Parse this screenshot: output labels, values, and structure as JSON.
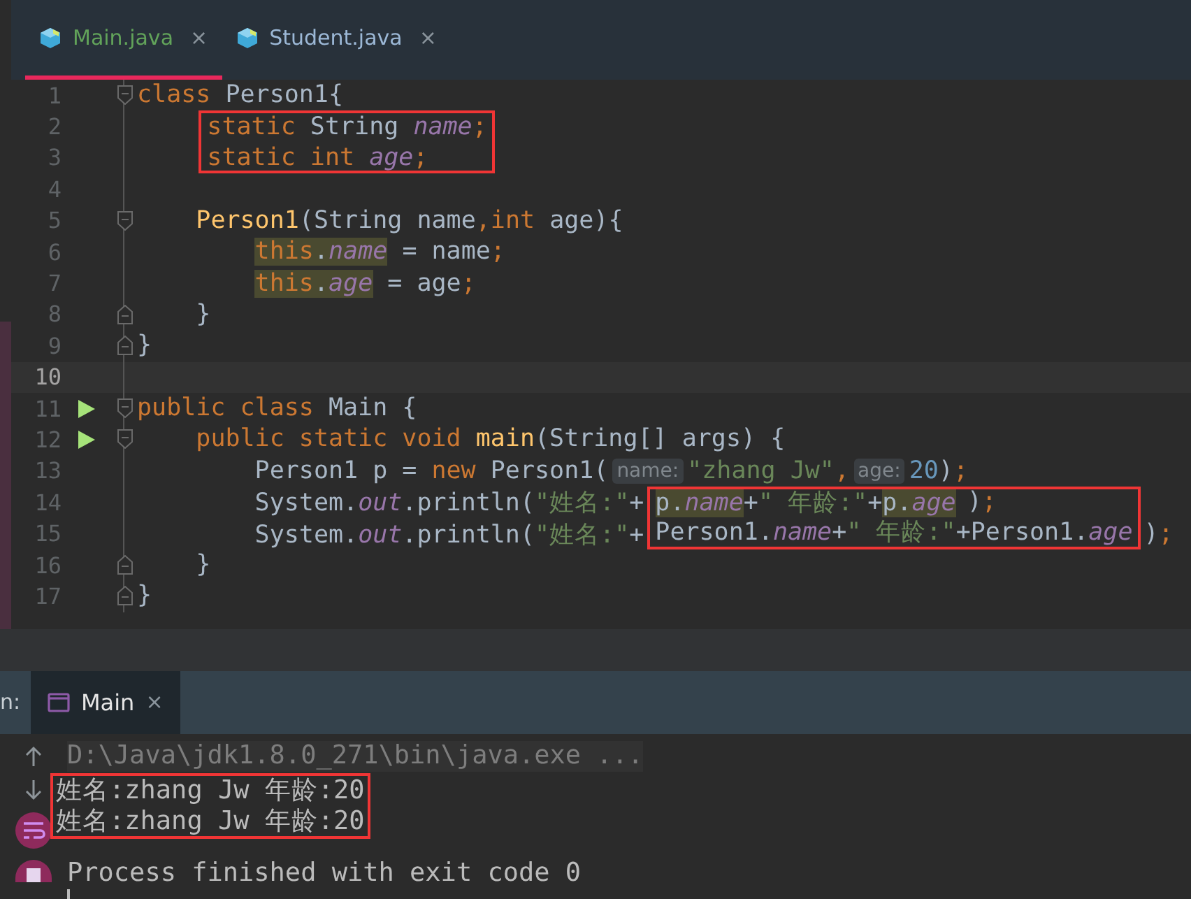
{
  "tabs": [
    {
      "label": "Main.java",
      "selected": true,
      "color": "#62a35a",
      "close": "×"
    },
    {
      "label": "Student.java",
      "selected": false,
      "color": "#9cb8d6",
      "close": "×"
    }
  ],
  "editor": {
    "lines": [
      {
        "number": "1",
        "kind": "fold_start",
        "segments": [
          {
            "tokens": [
              {
                "text": "class ",
                "kind": "keyword"
              },
              {
                "text": "Person1{",
                "kind": "plain"
              }
            ]
          }
        ]
      },
      {
        "number": "2",
        "kind": "code",
        "segments": [
          {
            "boxed": true,
            "tokens": [
              {
                "text": "    static ",
                "kind": "keyword"
              },
              {
                "text": "String ",
                "kind": "plain"
              },
              {
                "text": "name",
                "kind": "field"
              },
              {
                "text": ";",
                "kind": "punct"
              }
            ]
          }
        ]
      },
      {
        "number": "3",
        "kind": "code",
        "segments": [
          {
            "boxed": true,
            "tokens": [
              {
                "text": "    static int ",
                "kind": "keyword"
              },
              {
                "text": "age",
                "kind": "field"
              },
              {
                "text": ";",
                "kind": "punct"
              }
            ]
          }
        ]
      },
      {
        "number": "4",
        "kind": "code"
      },
      {
        "number": "5",
        "kind": "fold_start",
        "segments": [
          {
            "tokens": [
              {
                "text": "    Person1",
                "kind": "method"
              },
              {
                "text": "(String name",
                "kind": "plain"
              },
              {
                "text": ",",
                "kind": "punct"
              },
              {
                "text": "int ",
                "kind": "keyword"
              },
              {
                "text": "age){",
                "kind": "plain"
              }
            ]
          }
        ]
      },
      {
        "number": "6",
        "kind": "code",
        "segments": [
          {
            "tokens": [
              {
                "text": "        this",
                "kind": "keyword",
                "highlighted": true
              },
              {
                "text": ".",
                "kind": "plain",
                "highlighted": true
              },
              {
                "text": "name",
                "kind": "field",
                "highlighted": true
              },
              {
                "text": " = name",
                "kind": "plain",
                "highlighted": false
              },
              {
                "text": ";",
                "kind": "punct",
                "highlighted": false
              }
            ]
          }
        ]
      },
      {
        "number": "7",
        "kind": "code",
        "segments": [
          {
            "tokens": [
              {
                "text": "        this",
                "kind": "keyword",
                "highlighted": true
              },
              {
                "text": ".",
                "kind": "plain",
                "highlighted": true
              },
              {
                "text": "age",
                "kind": "field",
                "highlighted": true
              },
              {
                "text": " = age",
                "kind": "plain",
                "highlighted": false
              },
              {
                "text": ";",
                "kind": "punct",
                "highlighted": false
              }
            ]
          }
        ]
      },
      {
        "number": "8",
        "kind": "fold_end",
        "segments": [
          {
            "tokens": [
              {
                "text": "    }",
                "kind": "plain"
              }
            ]
          }
        ]
      },
      {
        "number": "9",
        "kind": "fold_end",
        "segments": [
          {
            "tokens": [
              {
                "text": "}",
                "kind": "plain"
              }
            ]
          }
        ]
      },
      {
        "number": "10",
        "kind": "code",
        "current": true
      },
      {
        "number": "11",
        "kind": "fold_start",
        "run": true,
        "segments": [
          {
            "tokens": [
              {
                "text": "public class ",
                "kind": "keyword"
              },
              {
                "text": "Main {",
                "kind": "plain"
              }
            ]
          }
        ]
      },
      {
        "number": "12",
        "kind": "fold_start",
        "run": true,
        "segments": [
          {
            "tokens": [
              {
                "text": "    public static void ",
                "kind": "keyword"
              },
              {
                "text": "main",
                "kind": "method"
              },
              {
                "text": "(String[] args) {",
                "kind": "plain"
              }
            ]
          }
        ]
      },
      {
        "number": "13",
        "kind": "code",
        "segments": [
          {
            "tokens": [
              {
                "text": "        Person1 p = ",
                "kind": "plain"
              },
              {
                "text": "new ",
                "kind": "keyword"
              },
              {
                "text": "Person1(",
                "kind": "plain"
              },
              {
                "text": "name:",
                "kind": "hint"
              },
              {
                "text": "\"zhang Jw\"",
                "kind": "string"
              },
              {
                "text": ",",
                "kind": "punct"
              },
              {
                "text": "age:",
                "kind": "hint"
              },
              {
                "text": "20",
                "kind": "number"
              },
              {
                "text": ")",
                "kind": "plain"
              },
              {
                "text": ";",
                "kind": "punct"
              }
            ]
          }
        ]
      },
      {
        "number": "14",
        "kind": "code",
        "segments": [
          {
            "tokens": [
              {
                "text": "        System.",
                "kind": "plain"
              },
              {
                "text": "out",
                "kind": "field"
              },
              {
                "text": ".println(",
                "kind": "plain"
              },
              {
                "text": "\"姓名:\"",
                "kind": "string"
              },
              {
                "text": "+",
                "kind": "plain"
              }
            ]
          },
          {
            "boxed": true,
            "tokens": [
              {
                "text": "p.",
                "kind": "plain",
                "highlighted": true
              },
              {
                "text": "name",
                "kind": "field",
                "highlighted": true
              },
              {
                "text": "+",
                "kind": "plain",
                "highlighted": false
              },
              {
                "text": "\" 年龄:\"",
                "kind": "string",
                "highlighted": false
              },
              {
                "text": "+",
                "kind": "plain",
                "highlighted": false
              },
              {
                "text": "p.",
                "kind": "plain",
                "highlighted": true
              },
              {
                "text": "age",
                "kind": "field",
                "highlighted": true
              }
            ]
          },
          {
            "tokens": [
              {
                "text": ")",
                "kind": "plain"
              },
              {
                "text": ";",
                "kind": "punct"
              }
            ]
          }
        ]
      },
      {
        "number": "15",
        "kind": "code",
        "segments": [
          {
            "tokens": [
              {
                "text": "        System.",
                "kind": "plain"
              },
              {
                "text": "out",
                "kind": "field"
              },
              {
                "text": ".println(",
                "kind": "plain"
              },
              {
                "text": "\"姓名:\"",
                "kind": "string"
              },
              {
                "text": "+",
                "kind": "plain"
              }
            ]
          },
          {
            "boxed": true,
            "tokens": [
              {
                "text": "Person1.",
                "kind": "plain"
              },
              {
                "text": "name",
                "kind": "field"
              },
              {
                "text": "+",
                "kind": "plain"
              },
              {
                "text": "\" 年龄:\"",
                "kind": "string"
              },
              {
                "text": "+Person1.",
                "kind": "plain"
              },
              {
                "text": "age",
                "kind": "field"
              }
            ]
          },
          {
            "tokens": [
              {
                "text": ")",
                "kind": "plain"
              },
              {
                "text": ";",
                "kind": "punct"
              }
            ]
          }
        ]
      },
      {
        "number": "16",
        "kind": "fold_end",
        "segments": [
          {
            "tokens": [
              {
                "text": "    }",
                "kind": "plain"
              }
            ]
          }
        ]
      },
      {
        "number": "17",
        "kind": "fold_end",
        "segments": [
          {
            "tokens": [
              {
                "text": "}",
                "kind": "plain"
              }
            ]
          }
        ]
      }
    ]
  },
  "run_panel": {
    "label": "n:",
    "tabs": [
      {
        "label": "Main",
        "selected": true,
        "close": "×"
      }
    ]
  },
  "console": {
    "caret": true,
    "lines": [
      {
        "text": "D:\\Java\\jdk1.8.0_271\\bin\\java.exe ...",
        "kind": "command",
        "boxed": false
      },
      {
        "text": "姓名:zhang Jw 年龄:20",
        "kind": "output",
        "boxed": true
      },
      {
        "text": "姓名:zhang Jw 年龄:20",
        "kind": "output",
        "boxed": true
      },
      {
        "text": "Process finished with exit code 0",
        "kind": "system",
        "boxed": false
      }
    ]
  }
}
